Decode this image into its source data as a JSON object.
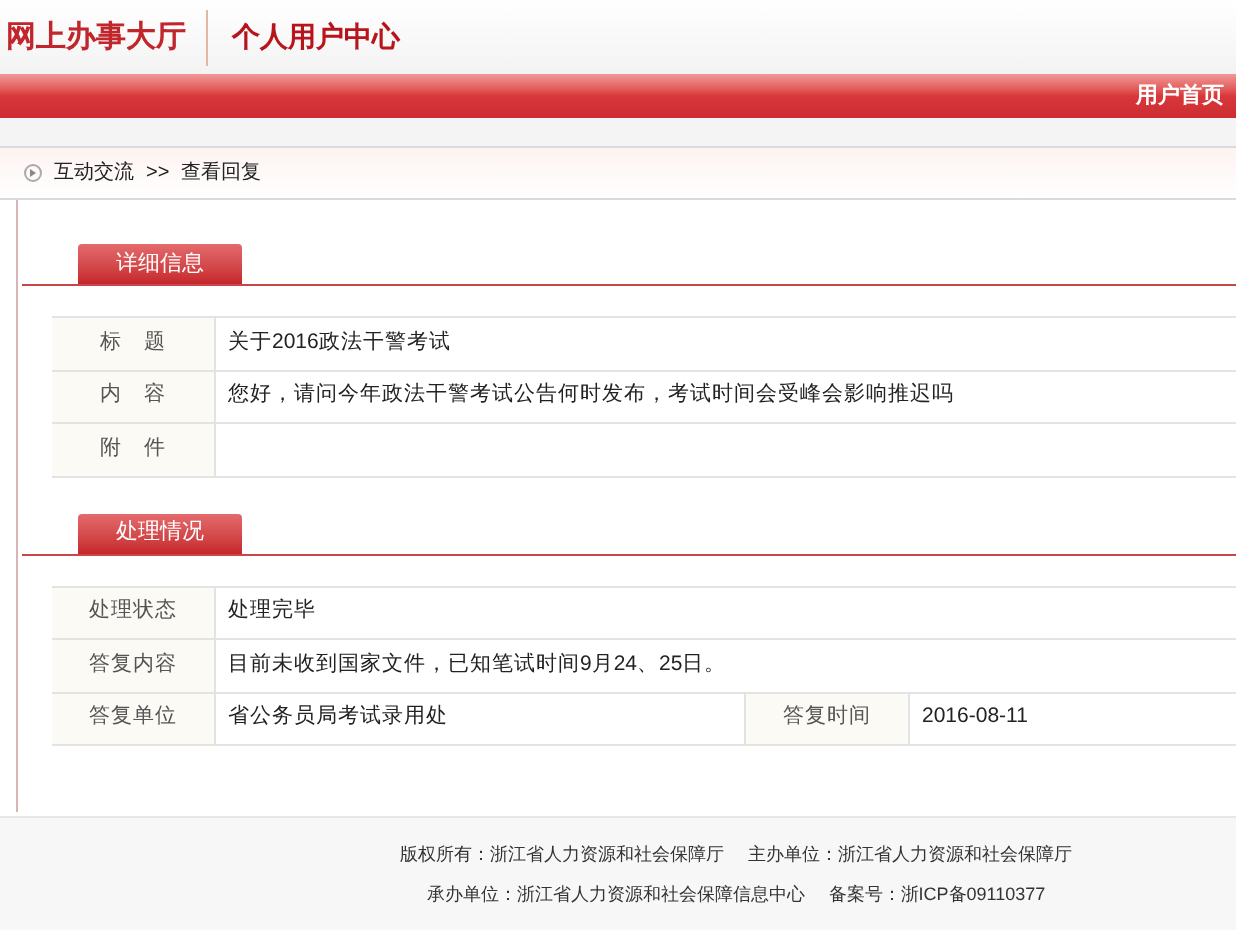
{
  "header": {
    "logo": "网上办事大厅",
    "title": "个人用户中心"
  },
  "nav": {
    "link": "用户首页"
  },
  "breadcrumb": [
    "互动交流",
    ">>",
    "查看回复"
  ],
  "sections": [
    {
      "title": "详细信息",
      "rows": [
        [
          {
            "label": "标　题",
            "value": "关于2016政法干警考试"
          }
        ],
        [
          {
            "label": "内　容",
            "value": "您好，请问今年政法干警考试公告何时发布，考试时间会受峰会影响推迟吗"
          }
        ],
        [
          {
            "label": "附　件"
          }
        ]
      ]
    },
    {
      "title": "处理情况",
      "rows": [
        [
          {
            "label": "处理状态",
            "value": "处理完毕"
          }
        ],
        [
          {
            "label": "答复内容",
            "value": "目前未收到国家文件，已知笔试时间9月24、25日。"
          }
        ],
        [
          {
            "label": "答复单位",
            "value": "省公务员局考试录用处"
          },
          {
            "label": "答复时间",
            "value": "2016-08-11"
          }
        ]
      ]
    }
  ],
  "footer": [
    [
      "版权所有：浙江省人力资源和社会保障厅",
      "主办单位：浙江省人力资源和社会保障厅"
    ],
    [
      "承办单位：浙江省人力资源和社会保障信息中心",
      "备案号：浙ICP备09110377"
    ]
  ]
}
